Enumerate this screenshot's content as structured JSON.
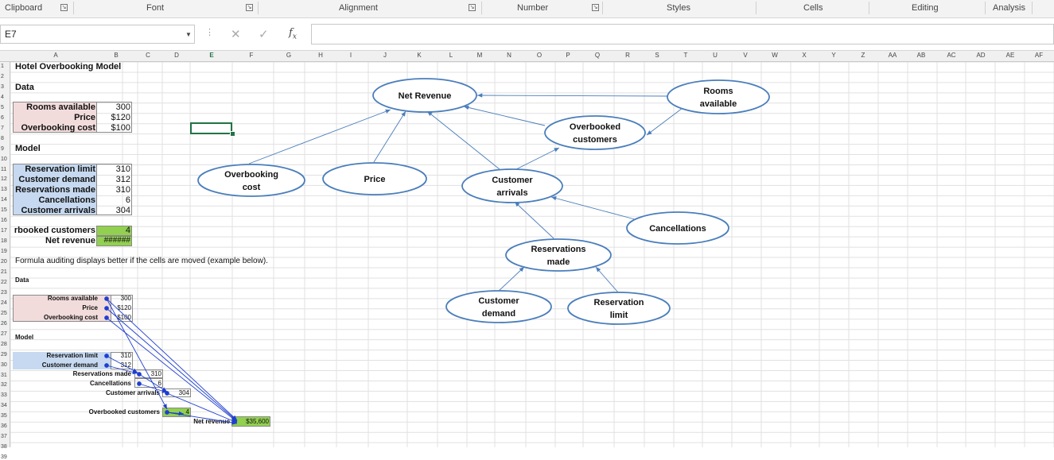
{
  "ribbon": {
    "groups": [
      "Clipboard",
      "Font",
      "Alignment",
      "Number",
      "Styles",
      "Cells",
      "Editing",
      "Analysis"
    ]
  },
  "formula_bar": {
    "name_box": "E7",
    "formula": "",
    "fx": "fx"
  },
  "columns": [
    "A",
    "B",
    "C",
    "D",
    "E",
    "F",
    "G",
    "H",
    "I",
    "J",
    "K",
    "L",
    "M",
    "N",
    "O",
    "P",
    "Q",
    "R",
    "S",
    "T",
    "U",
    "V",
    "W",
    "X",
    "Y",
    "Z",
    "AA",
    "AB",
    "AC",
    "AD",
    "AE",
    "AF"
  ],
  "rows": [
    "1",
    "2",
    "3",
    "4",
    "5",
    "6",
    "7",
    "8",
    "9",
    "10",
    "11",
    "12",
    "13",
    "14",
    "15",
    "16",
    "17",
    "18",
    "19",
    "20",
    "21",
    "22",
    "23",
    "24",
    "25",
    "26",
    "27",
    "28",
    "29",
    "30",
    "31",
    "32",
    "33",
    "34",
    "35",
    "36",
    "37",
    "38",
    "39"
  ],
  "sheet": {
    "title": "Hotel Overbooking Model",
    "data_heading": "Data",
    "model_heading": "Model",
    "data": [
      {
        "label": "Rooms available",
        "value": "300"
      },
      {
        "label": "Price",
        "value": "$120"
      },
      {
        "label": "Overbooking cost",
        "value": "$100"
      }
    ],
    "model": [
      {
        "label": "Reservation limit",
        "value": "310"
      },
      {
        "label": "Customer demand",
        "value": "312"
      },
      {
        "label": "Reservations made",
        "value": "310"
      },
      {
        "label": "Cancellations",
        "value": "6"
      },
      {
        "label": "Customer arrivals",
        "value": "304"
      }
    ],
    "overbooked_label": "rbooked customers",
    "overbooked_value": "4",
    "net_revenue_label": "Net revenue",
    "net_revenue_value": "######",
    "note": "Formula auditing displays better if the cells are moved (example below).",
    "example": {
      "data_heading": "Data",
      "model_heading": "Model",
      "rooms_label": "Rooms available",
      "rooms_value": "300",
      "price_label": "Price",
      "price_value": "$120",
      "cost_label": "Overbooking cost",
      "cost_value": "$100",
      "limit_label": "Reservation limit",
      "limit_value": "310",
      "demand_label": "Customer demand",
      "demand_value": "312",
      "made_label": "Reservations made",
      "made_value": "310",
      "cancel_label": "Cancellations",
      "cancel_value": "6",
      "arrivals_label": "Customer arrivals",
      "arrivals_value": "304",
      "overbooked_label": "Overbooked customers",
      "overbooked_value": "4",
      "net_label": "Net revenue",
      "net_value": "$35,600"
    }
  },
  "diagram": {
    "nodes": [
      {
        "id": "net",
        "lines": [
          "Net Revenue"
        ]
      },
      {
        "id": "rooms",
        "lines": [
          "Rooms",
          "available"
        ]
      },
      {
        "id": "overbooked",
        "lines": [
          "Overbooked",
          "customers"
        ]
      },
      {
        "id": "cost",
        "lines": [
          "Overbooking",
          "cost"
        ]
      },
      {
        "id": "price",
        "lines": [
          "Price"
        ]
      },
      {
        "id": "arrivals",
        "lines": [
          "Customer",
          "arrivals"
        ]
      },
      {
        "id": "cancellations",
        "lines": [
          "Cancellations"
        ]
      },
      {
        "id": "made",
        "lines": [
          "Reservations",
          "made"
        ]
      },
      {
        "id": "demand",
        "lines": [
          "Customer",
          "demand"
        ]
      },
      {
        "id": "limit",
        "lines": [
          "Reservation",
          "limit"
        ]
      }
    ],
    "colors": {
      "stroke": "#4a7ebb",
      "trace": "#1f3fd0",
      "grid": "#e1e1e1",
      "selection": "#217346"
    }
  }
}
